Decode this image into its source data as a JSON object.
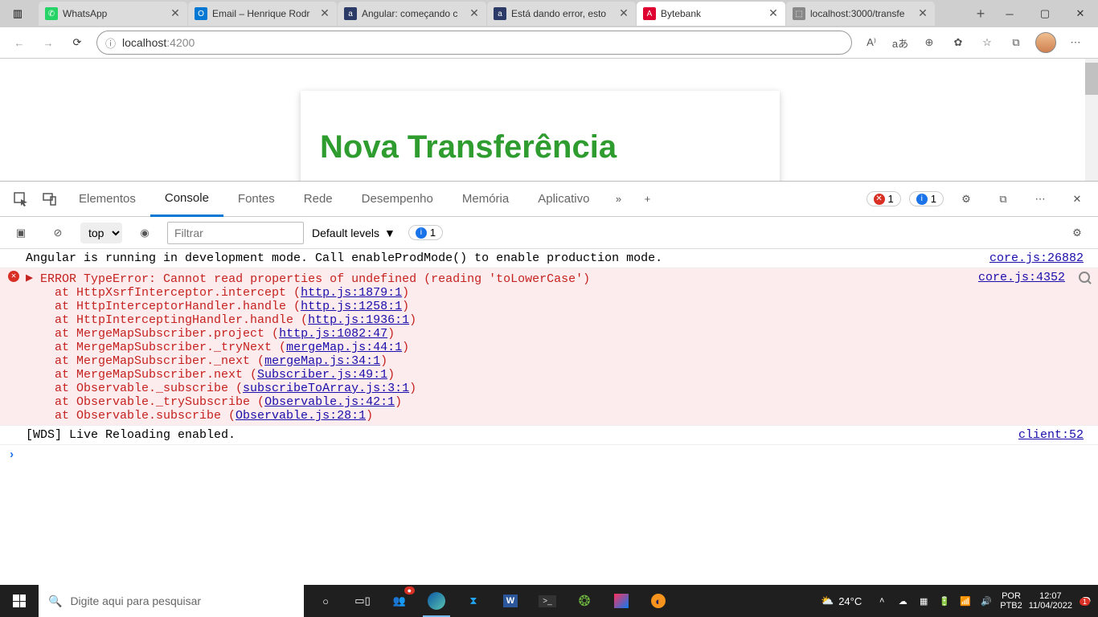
{
  "browser": {
    "tabs": [
      {
        "icon_bg": "#25d366",
        "icon_txt": "✆",
        "title": "WhatsApp"
      },
      {
        "icon_bg": "#0078d4",
        "icon_txt": "O",
        "title": "Email – Henrique Rodr"
      },
      {
        "icon_bg": "#2b3a67",
        "icon_txt": "a",
        "title": "Angular: começando c"
      },
      {
        "icon_bg": "#2b3a67",
        "icon_txt": "a",
        "title": "Está dando error, esto"
      },
      {
        "icon_bg": "#dd0031",
        "icon_txt": "A",
        "title": "Bytebank"
      },
      {
        "icon_bg": "#888",
        "icon_txt": "⬚",
        "title": "localhost:3000/transfe"
      }
    ],
    "active_tab_index": 4,
    "url_host": "localhost",
    "url_rest": ":4200"
  },
  "page": {
    "heading": "Nova Transferência"
  },
  "devtools": {
    "tabs": [
      "Elementos",
      "Console",
      "Fontes",
      "Rede",
      "Desempenho",
      "Memória",
      "Aplicativo"
    ],
    "active_tab": "Console",
    "error_count": "1",
    "info_count": "1",
    "context": "top",
    "filter_placeholder": "Filtrar",
    "levels_label": "Default levels",
    "issues_count": "1",
    "log1": {
      "msg": "Angular is running in development mode. Call enableProdMode() to enable production mode.",
      "src": "core.js:26882"
    },
    "err": {
      "head": "ERROR TypeError: Cannot read properties of undefined (reading 'toLowerCase')",
      "src": "core.js:4352",
      "lines": [
        {
          "pre": "    at HttpXsrfInterceptor.intercept (",
          "link": "http.js:1879:1",
          "post": ")"
        },
        {
          "pre": "    at HttpInterceptorHandler.handle (",
          "link": "http.js:1258:1",
          "post": ")"
        },
        {
          "pre": "    at HttpInterceptingHandler.handle (",
          "link": "http.js:1936:1",
          "post": ")"
        },
        {
          "pre": "    at MergeMapSubscriber.project (",
          "link": "http.js:1082:47",
          "post": ")"
        },
        {
          "pre": "    at MergeMapSubscriber._tryNext (",
          "link": "mergeMap.js:44:1",
          "post": ")"
        },
        {
          "pre": "    at MergeMapSubscriber._next (",
          "link": "mergeMap.js:34:1",
          "post": ")"
        },
        {
          "pre": "    at MergeMapSubscriber.next (",
          "link": "Subscriber.js:49:1",
          "post": ")"
        },
        {
          "pre": "    at Observable._subscribe (",
          "link": "subscribeToArray.js:3:1",
          "post": ")"
        },
        {
          "pre": "    at Observable._trySubscribe (",
          "link": "Observable.js:42:1",
          "post": ")"
        },
        {
          "pre": "    at Observable.subscribe (",
          "link": "Observable.js:28:1",
          "post": ")"
        }
      ]
    },
    "log2": {
      "msg": "[WDS] Live Reloading enabled.",
      "src": "client:52"
    }
  },
  "taskbar": {
    "search_placeholder": "Digite aqui para pesquisar",
    "weather_temp": "24°C",
    "lang": "POR",
    "kb": "PTB2",
    "time": "12:07",
    "date": "11/04/2022",
    "notif": "1"
  }
}
